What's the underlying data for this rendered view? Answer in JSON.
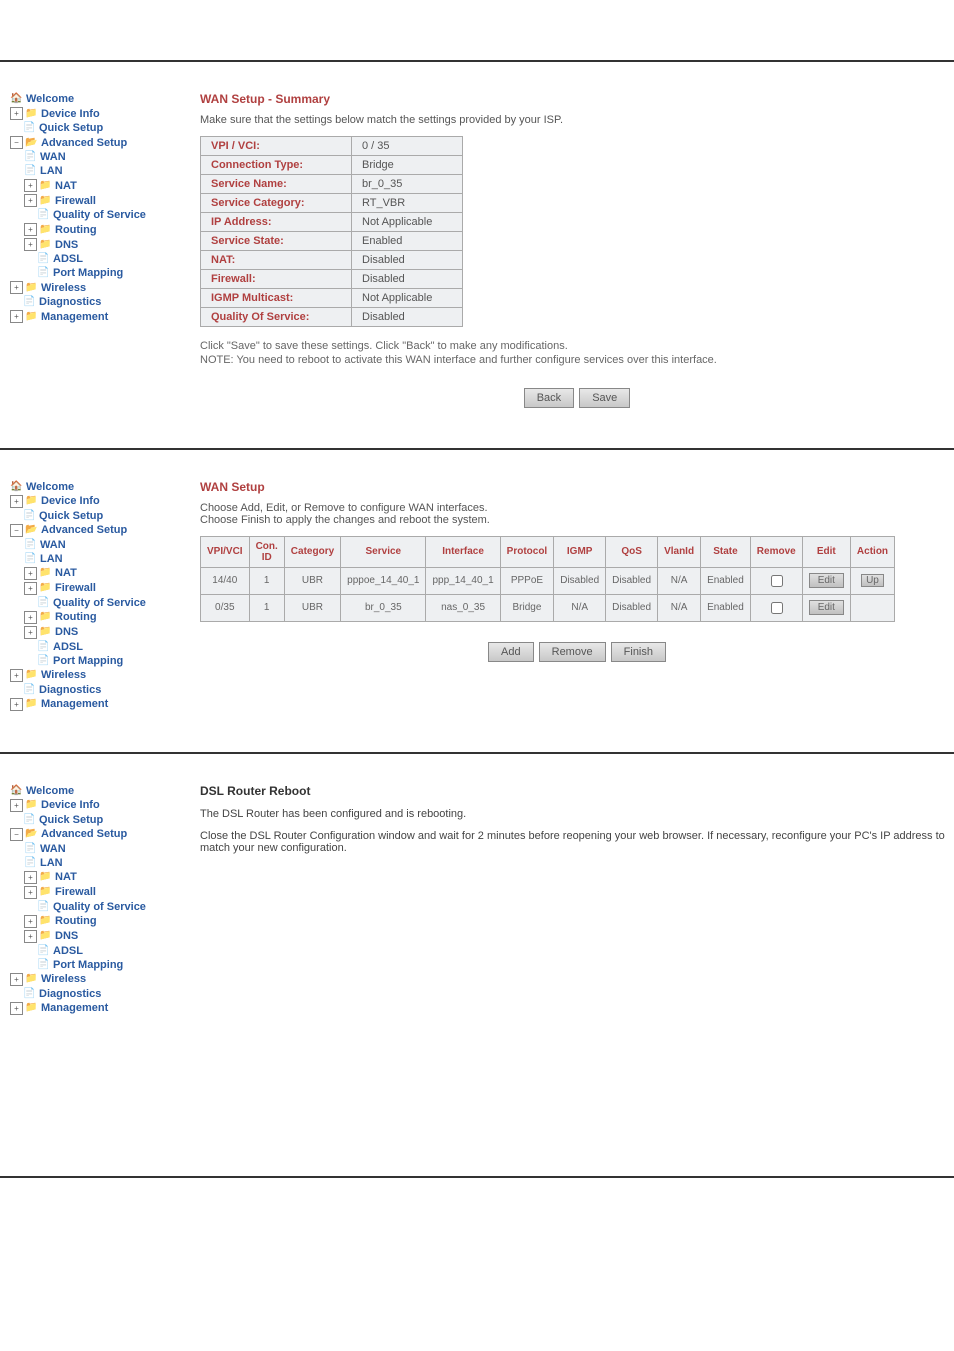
{
  "nav": {
    "welcome": "Welcome",
    "device_info": "Device Info",
    "quick_setup": "Quick Setup",
    "advanced_setup": "Advanced Setup",
    "wan": "WAN",
    "lan": "LAN",
    "nat": "NAT",
    "firewall": "Firewall",
    "qos": "Quality of Service",
    "routing": "Routing",
    "dns": "DNS",
    "adsl": "ADSL",
    "port_mapping": "Port Mapping",
    "wireless": "Wireless",
    "diagnostics": "Diagnostics",
    "management": "Management"
  },
  "summary": {
    "title": "WAN Setup - Summary",
    "subtitle": "Make sure that the settings below match the settings provided by your ISP.",
    "rows": [
      {
        "label": "VPI / VCI:",
        "value": "0 / 35"
      },
      {
        "label": "Connection Type:",
        "value": "Bridge"
      },
      {
        "label": "Service Name:",
        "value": "br_0_35"
      },
      {
        "label": "Service Category:",
        "value": "RT_VBR"
      },
      {
        "label": "IP Address:",
        "value": "Not Applicable"
      },
      {
        "label": "Service State:",
        "value": "Enabled"
      },
      {
        "label": "NAT:",
        "value": "Disabled"
      },
      {
        "label": "Firewall:",
        "value": "Disabled"
      },
      {
        "label": "IGMP Multicast:",
        "value": "Not Applicable"
      },
      {
        "label": "Quality Of Service:",
        "value": "Disabled"
      }
    ],
    "note1": "Click \"Save\" to save these settings. Click \"Back\" to make any modifications.",
    "note2": "NOTE: You need to reboot to activate this WAN interface and further configure services over this interface.",
    "back": "Back",
    "save": "Save"
  },
  "wanlist": {
    "title": "WAN Setup",
    "sub1": "Choose Add, Edit, or Remove to configure WAN interfaces.",
    "sub2": "Choose Finish to apply the changes and reboot the system.",
    "headers": [
      "VPI/VCI",
      "Con. ID",
      "Category",
      "Service",
      "Interface",
      "Protocol",
      "IGMP",
      "QoS",
      "VlanId",
      "State",
      "Remove",
      "Edit",
      "Action"
    ],
    "rows": [
      {
        "c0": "14/40",
        "c1": "1",
        "c2": "UBR",
        "c3": "pppoe_14_40_1",
        "c4": "ppp_14_40_1",
        "c5": "PPPoE",
        "c6": "Disabled",
        "c7": "Disabled",
        "c8": "N/A",
        "c9": "Enabled",
        "edit": "Edit",
        "action": "Up"
      },
      {
        "c0": "0/35",
        "c1": "1",
        "c2": "UBR",
        "c3": "br_0_35",
        "c4": "nas_0_35",
        "c5": "Bridge",
        "c6": "N/A",
        "c7": "Disabled",
        "c8": "N/A",
        "c9": "Enabled",
        "edit": "Edit",
        "action": ""
      }
    ],
    "add": "Add",
    "remove": "Remove",
    "finish": "Finish"
  },
  "reboot": {
    "title": "DSL Router Reboot",
    "line1": "The DSL Router has been configured and is rebooting.",
    "line2": "Close the DSL Router Configuration window and wait for 2 minutes before reopening your web browser. If necessary, reconfigure your PC's IP address to match your new configuration."
  }
}
